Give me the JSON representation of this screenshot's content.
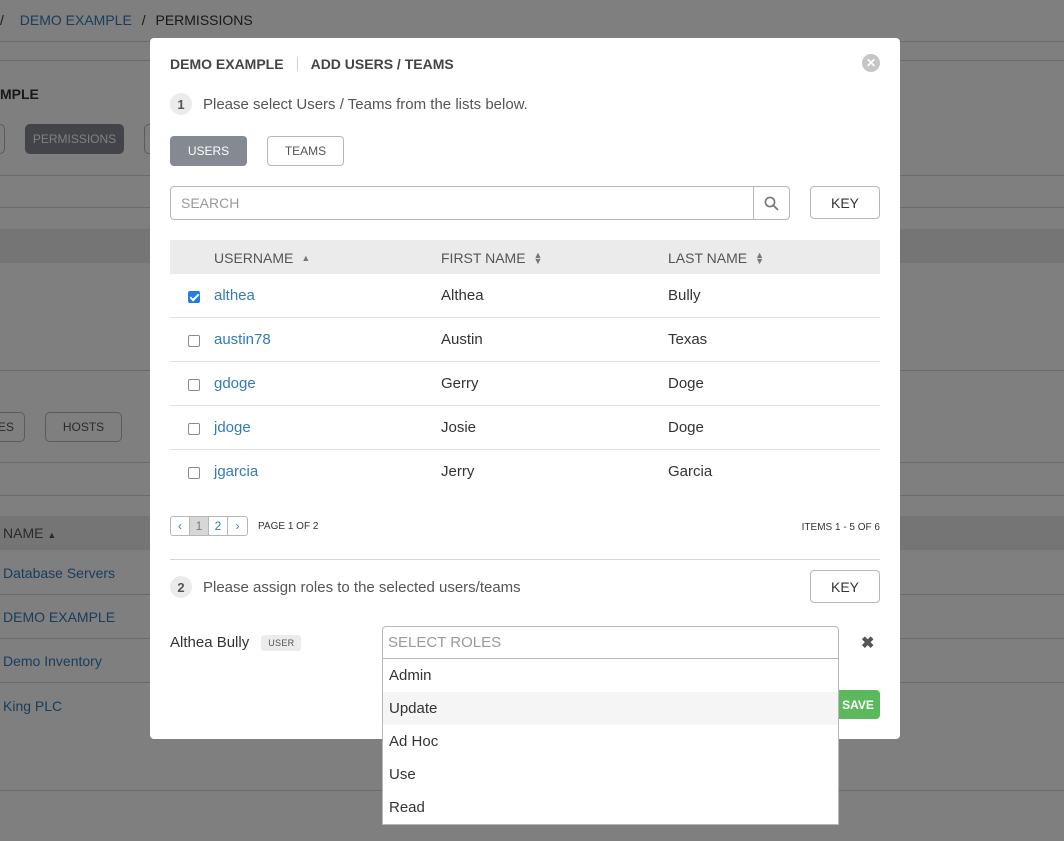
{
  "background": {
    "breadcrumb": {
      "sep_start": "/",
      "demo_example": "DEMO EXAMPLE",
      "sep": "/",
      "permissions": "PERMISSIONS"
    },
    "title_fragment": "MPLE",
    "tabs": {
      "permissions": "PERMISSIONS"
    },
    "subtabs": {
      "partial": "ES",
      "hosts": "HOSTS"
    },
    "table_header": "NAME",
    "rows": [
      "Database Servers",
      "DEMO EXAMPLE",
      "Demo Inventory",
      "King PLC"
    ]
  },
  "modal": {
    "title_left": "DEMO EXAMPLE",
    "title_right": "ADD USERS / TEAMS",
    "step1": {
      "num": "1",
      "text": "Please select Users / Teams from the lists below."
    },
    "toggle": {
      "users": "USERS",
      "teams": "TEAMS"
    },
    "search": {
      "placeholder": "SEARCH",
      "value": ""
    },
    "key_label": "KEY",
    "columns": [
      "USERNAME",
      "FIRST NAME",
      "LAST NAME"
    ],
    "rows": [
      {
        "username": "althea",
        "first": "Althea",
        "last": "Bully",
        "checked": true
      },
      {
        "username": "austin78",
        "first": "Austin",
        "last": "Texas",
        "checked": false
      },
      {
        "username": "gdoge",
        "first": "Gerry",
        "last": "Doge",
        "checked": false
      },
      {
        "username": "jdoge",
        "first": "Josie",
        "last": "Doge",
        "checked": false
      },
      {
        "username": "jgarcia",
        "first": "Jerry",
        "last": "Garcia",
        "checked": false
      }
    ],
    "pager": {
      "prev": "‹",
      "pages": [
        "1",
        "2"
      ],
      "next": "›",
      "label": "PAGE 1 OF 2",
      "current": 1
    },
    "items_label": "ITEMS  1 - 5 OF 6",
    "step2": {
      "num": "2",
      "text": "Please assign roles to the selected users/teams"
    },
    "key2_label": "KEY",
    "assign": {
      "name": "Althea Bully",
      "badge": "USER",
      "roles_placeholder": "SELECT ROLES",
      "remove": "✖"
    },
    "save_label": "SAVE",
    "role_options": [
      "Admin",
      "Update",
      "Ad Hoc",
      "Use",
      "Read"
    ],
    "highlighted_option": "Update",
    "close": "✕"
  },
  "colors": {
    "link": "#337ab7",
    "active_button": "#848992",
    "save": "#5cb85c",
    "checkbox": "#1e7ee6"
  }
}
